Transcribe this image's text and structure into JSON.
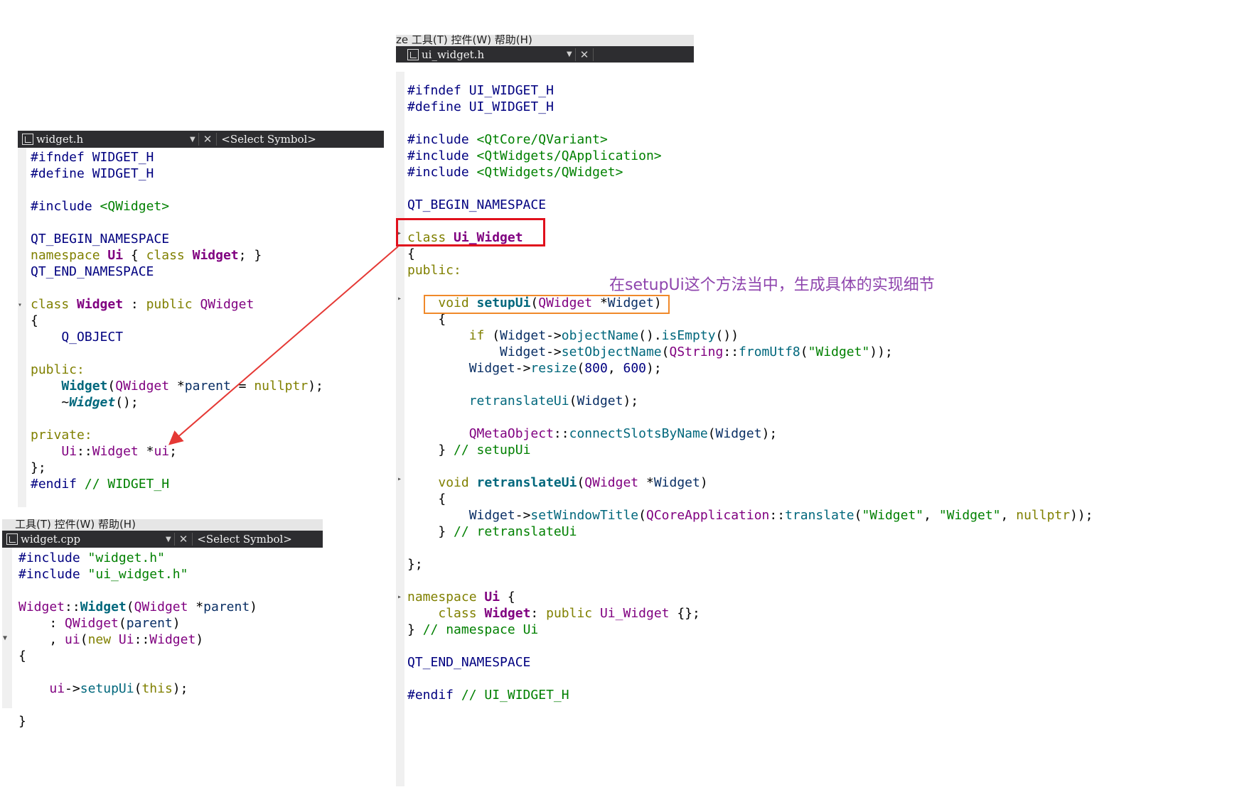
{
  "annotation": "在setupUi这个方法当中，生成具体的实现细节",
  "colors": {
    "red_box": "#e0101c",
    "orange_box": "#f0892a",
    "arrow": "#e53935",
    "annotation": "#8e44ad"
  },
  "right_panel": {
    "menu_strip": "ze   工具(T)  控件(W)  帮助(H)",
    "tab": {
      "file": "ui_widget.h",
      "icon": "file-icon"
    }
  },
  "left_top_panel": {
    "tab": {
      "file": "widget.h",
      "symbol": "<Select Symbol>",
      "icon": "file-icon"
    }
  },
  "left_bottom_panel": {
    "menu_strip": "工具(T)  控件(W)  帮助(H)",
    "tab": {
      "file": "widget.cpp",
      "symbol": "<Select Symbol>",
      "icon": "file-icon"
    }
  },
  "widget_h": {
    "l1": "#ifndef WIDGET_H",
    "l2": "#define WIDGET_H",
    "l4a": "#include ",
    "l4b": "<QWidget>",
    "l6": "QT_BEGIN_NAMESPACE",
    "l7a": "namespace ",
    "l7b": "Ui",
    "l7c": " { ",
    "l7d": "class ",
    "l7e": "Widget",
    "l7f": "; }",
    "l8": "QT_END_NAMESPACE",
    "l10a": "class ",
    "l10b": "Widget",
    "l10c": " : ",
    "l10d": "public ",
    "l10e": "QWidget",
    "l11": "{",
    "l12": "    Q_OBJECT",
    "l14": "public:",
    "l15a": "    ",
    "l15b": "Widget",
    "l15c": "(",
    "l15d": "QWidget",
    "l15e": " *",
    "l15f": "parent",
    "l15g": " = ",
    "l15h": "nullptr",
    "l15i": ");",
    "l16a": "    ~",
    "l16b": "Widget",
    "l16c": "();",
    "l18": "private:",
    "l19a": "    ",
    "l19b": "Ui",
    "l19c": "::",
    "l19d": "Widget",
    "l19e": " *",
    "l19f": "ui",
    "l19g": ";",
    "l20": "};",
    "l21a": "#endif ",
    "l21b": "// WIDGET_H"
  },
  "widget_cpp": {
    "l1a": "#include ",
    "l1b": "\"widget.h\"",
    "l2a": "#include ",
    "l2b": "\"ui_widget.h\"",
    "l4a": "Widget",
    "l4b": "::",
    "l4c": "Widget",
    "l4d": "(",
    "l4e": "QWidget",
    "l4f": " *",
    "l4g": "parent",
    "l4h": ")",
    "l5a": "    : ",
    "l5b": "QWidget",
    "l5c": "(",
    "l5d": "parent",
    "l5e": ")",
    "l6a": "    , ",
    "l6b": "ui",
    "l6c": "(",
    "l6d": "new ",
    "l6e": "Ui",
    "l6f": "::",
    "l6g": "Widget",
    "l6h": ")",
    "l7": "{",
    "l8a": "    ",
    "l8b": "ui",
    "l8c": "->",
    "l8d": "setupUi",
    "l8e": "(",
    "l8f": "this",
    "l8g": ");",
    "l9": "}"
  },
  "ui_widget_h": {
    "l1": "#ifndef UI_WIDGET_H",
    "l2": "#define UI_WIDGET_H",
    "l4a": "#include ",
    "l4b": "<QtCore/QVariant>",
    "l5a": "#include ",
    "l5b": "<QtWidgets/QApplication>",
    "l6a": "#include ",
    "l6b": "<QtWidgets/QWidget>",
    "l8": "QT_BEGIN_NAMESPACE",
    "l10a": "class ",
    "l10b": "Ui_Widget",
    "l11": "{",
    "l12": "public:",
    "l14a": "    ",
    "l14b": "void ",
    "l14c": "setupUi",
    "l14d": "(",
    "l14e": "QWidget",
    "l14f": " *",
    "l14g": "Widget",
    "l14h": ")",
    "l15": "    {",
    "l16a": "        ",
    "l16b": "if ",
    "l16c": "(",
    "l16d": "Widget",
    "l16e": "->",
    "l16f": "objectName",
    "l16g": "().",
    "l16h": "isEmpty",
    "l16i": "())",
    "l17a": "            ",
    "l17b": "Widget",
    "l17c": "->",
    "l17d": "setObjectName",
    "l17e": "(",
    "l17f": "QString",
    "l17g": "::",
    "l17h": "fromUtf8",
    "l17i": "(",
    "l17j": "\"Widget\"",
    "l17k": "));",
    "l18a": "        ",
    "l18b": "Widget",
    "l18c": "->",
    "l18d": "resize",
    "l18e": "(",
    "l18f": "800",
    "l18g": ", ",
    "l18h": "600",
    "l18i": ");",
    "l20a": "        ",
    "l20b": "retranslateUi",
    "l20c": "(",
    "l20d": "Widget",
    "l20e": ");",
    "l22a": "        ",
    "l22b": "QMetaObject",
    "l22c": "::",
    "l22d": "connectSlotsByName",
    "l22e": "(",
    "l22f": "Widget",
    "l22g": ");",
    "l23a": "    } ",
    "l23b": "// setupUi",
    "l25a": "    ",
    "l25b": "void ",
    "l25c": "retranslateUi",
    "l25d": "(",
    "l25e": "QWidget",
    "l25f": " *",
    "l25g": "Widget",
    "l25h": ")",
    "l26": "    {",
    "l27a": "        ",
    "l27b": "Widget",
    "l27c": "->",
    "l27d": "setWindowTitle",
    "l27e": "(",
    "l27f": "QCoreApplication",
    "l27g": "::",
    "l27h": "translate",
    "l27i": "(",
    "l27j": "\"Widget\"",
    "l27k": ", ",
    "l27l": "\"Widget\"",
    "l27m": ", ",
    "l27n": "nullptr",
    "l27o": "));",
    "l28a": "    } ",
    "l28b": "// retranslateUi",
    "l30": "};",
    "l32a": "namespace ",
    "l32b": "Ui",
    "l32c": " {",
    "l33a": "    ",
    "l33b": "class ",
    "l33c": "Widget",
    "l33d": ": ",
    "l33e": "public ",
    "l33f": "Ui_Widget",
    "l33g": " {};",
    "l34a": "} ",
    "l34b": "// namespace Ui",
    "l36": "QT_END_NAMESPACE",
    "l38a": "#endif ",
    "l38b": "// UI_WIDGET_H"
  }
}
